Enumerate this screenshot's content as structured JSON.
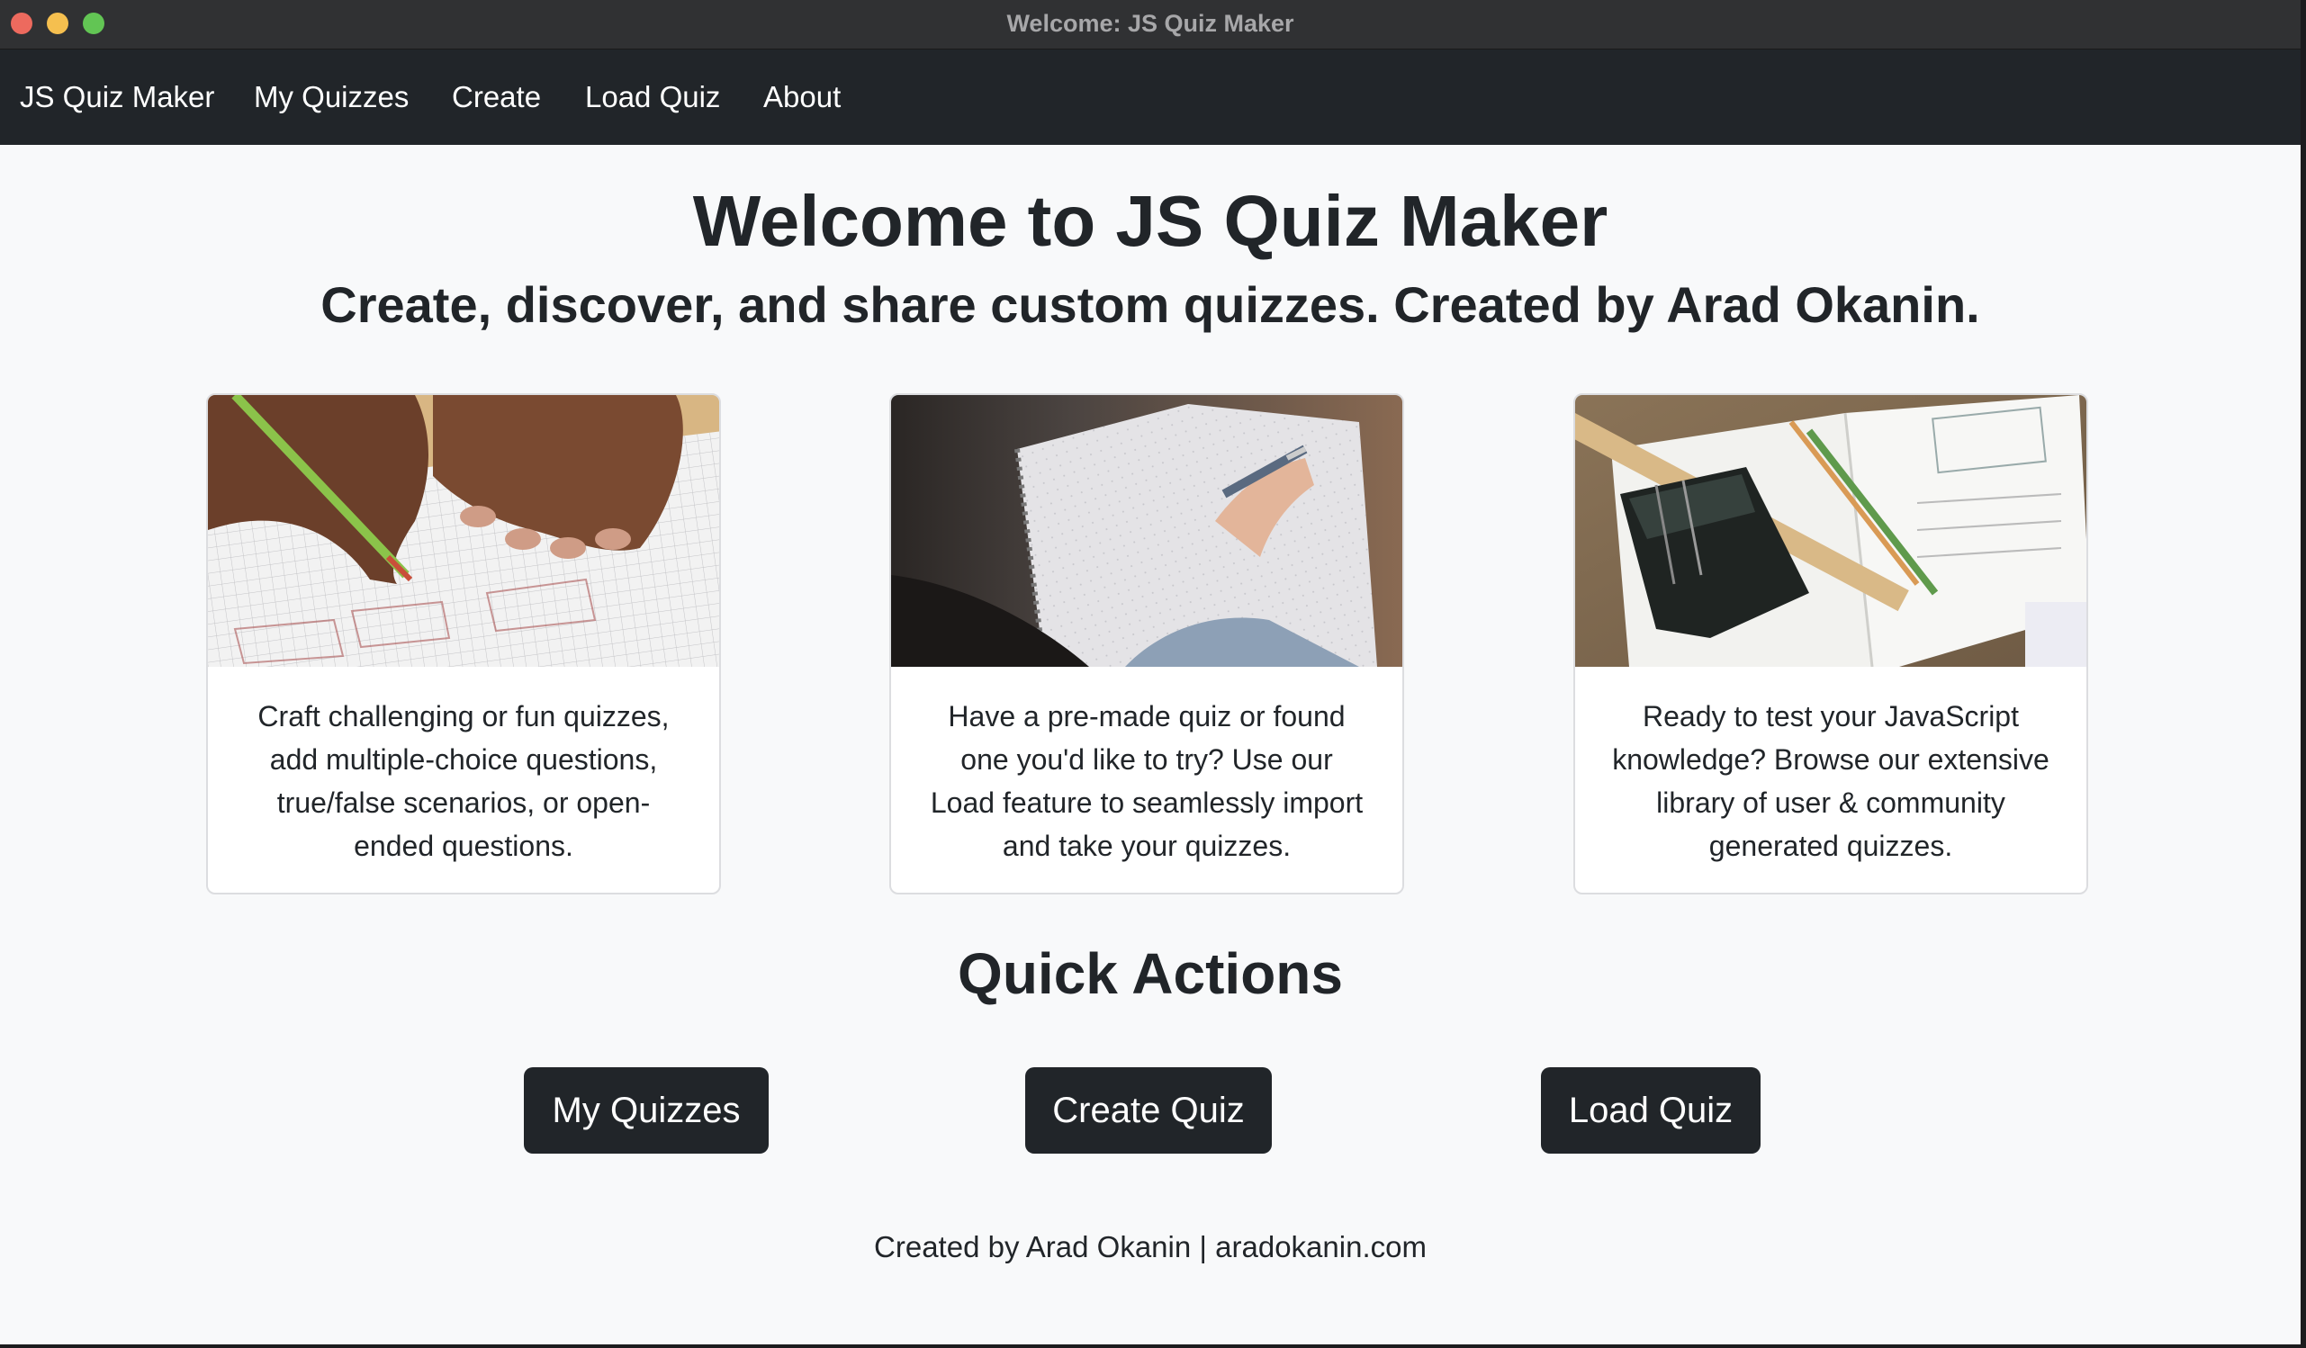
{
  "window": {
    "title": "Welcome: JS Quiz Maker"
  },
  "navbar": {
    "brand": "JS Quiz Maker",
    "items": [
      {
        "label": "My Quizzes"
      },
      {
        "label": "Create"
      },
      {
        "label": "Load Quiz"
      },
      {
        "label": "About"
      }
    ]
  },
  "hero": {
    "title": "Welcome to JS Quiz Maker",
    "subtitle": "Create, discover, and share custom quizzes. Created by Arad Okanin."
  },
  "cards": [
    {
      "image": "student-writing-on-graph-paper-photo",
      "text": "Craft challenging or fun quizzes, add multiple-choice questions, true/false scenarios, or open-ended questions."
    },
    {
      "image": "person-writing-in-notebook-photo",
      "text": "Have a pre-made quiz or found one you'd like to try? Use our Load feature to seamlessly import and take your quizzes."
    },
    {
      "image": "notebook-with-ruler-and-pencil-case-photo",
      "text": "Ready to test your JavaScript knowledge? Browse our extensive library of user & community generated quizzes."
    }
  ],
  "quick_actions": {
    "title": "Quick Actions",
    "buttons": [
      {
        "label": "My Quizzes"
      },
      {
        "label": "Create Quiz"
      },
      {
        "label": "Load Quiz"
      }
    ]
  },
  "footer": {
    "created_by": "Created by Arad Okanin",
    "separator": "|",
    "site": "aradokanin.com"
  },
  "colors": {
    "navbar_bg": "#212529",
    "page_bg": "#f8f9fa",
    "button_bg": "#212529",
    "text": "#212529"
  }
}
